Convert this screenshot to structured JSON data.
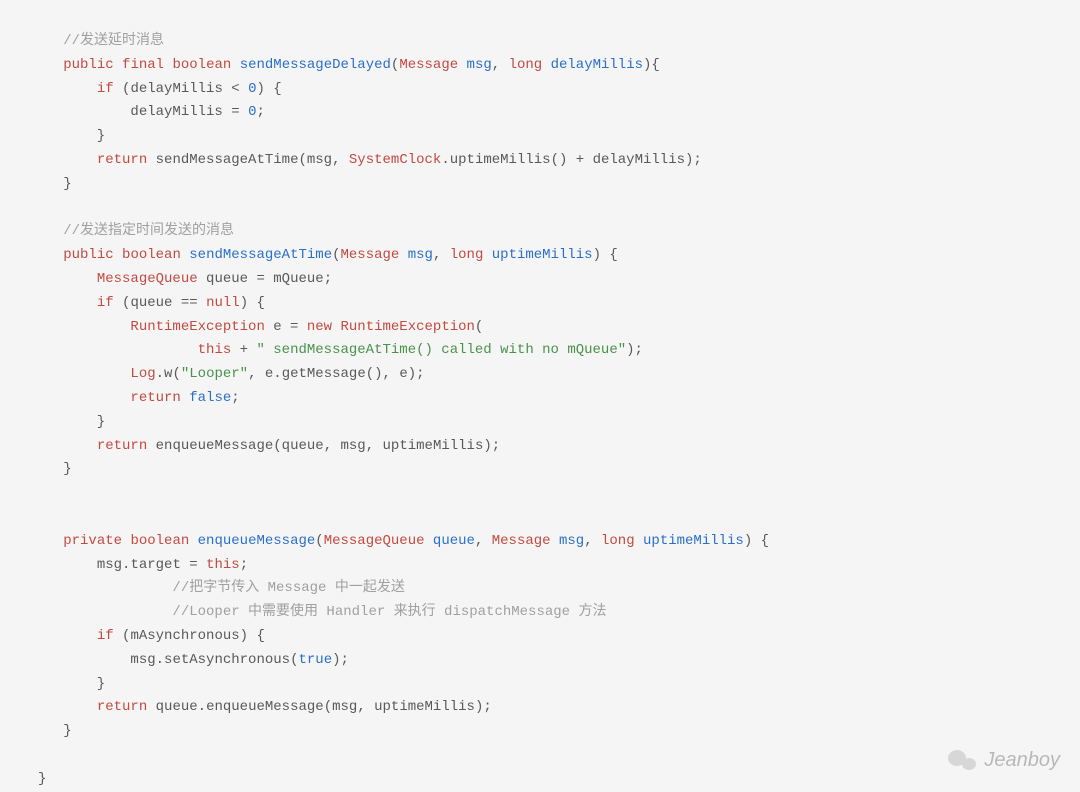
{
  "code": {
    "block1": {
      "comment": "//发送延时消息",
      "mod_public": "public",
      "mod_final": "final",
      "ret_boolean": "boolean",
      "fn_name": "sendMessageDelayed",
      "param_type1": "Message",
      "param_name1": "msg",
      "param_type2": "long",
      "param_name2": "delayMillis",
      "if_kw": "if",
      "cond_lhs": "delayMillis",
      "cond_op": "<",
      "cond_rhs": "0",
      "assign_lhs": "delayMillis",
      "assign_rhs": "0",
      "return_kw": "return",
      "call_fn": "sendMessageAtTime",
      "arg1": "msg",
      "arg2_owner": "SystemClock",
      "arg2_fn": "uptimeMillis",
      "arg2_tail": "delayMillis"
    },
    "block2": {
      "comment": "//发送指定时间发送的消息",
      "mod_public": "public",
      "ret_boolean": "boolean",
      "fn_name": "sendMessageAtTime",
      "param_type1": "Message",
      "param_name1": "msg",
      "param_type2": "long",
      "param_name2": "uptimeMillis",
      "type_mq": "MessageQueue",
      "var_queue": "queue",
      "rhs_mqueue": "mQueue",
      "if_kw": "if",
      "cond_lhs": "queue",
      "cond_op": "==",
      "cond_rhs": "null",
      "type_rte": "RuntimeException",
      "var_e": "e",
      "new_kw": "new",
      "ctor_rte": "RuntimeException",
      "this_kw": "this",
      "str_msg": "\" sendMessageAtTime() called with no mQueue\"",
      "log_owner": "Log",
      "log_fn": "w",
      "log_tag": "\"Looper\"",
      "log_arg2a": "e",
      "log_arg2b": "getMessage",
      "log_arg3": "e",
      "return1_kw": "return",
      "false_kw": "false",
      "return2_kw": "return",
      "call_fn": "enqueueMessage",
      "call_arg1": "queue",
      "call_arg2": "msg",
      "call_arg3": "uptimeMillis"
    },
    "block3": {
      "mod_private": "private",
      "ret_boolean": "boolean",
      "fn_name": "enqueueMessage",
      "param_type1": "MessageQueue",
      "param_name1": "queue",
      "param_type2": "Message",
      "param_name2": "msg",
      "param_type3": "long",
      "param_name3": "uptimeMillis",
      "lhs_owner": "msg",
      "lhs_field": "target",
      "rhs_this": "this",
      "comment1": "//把字节传入 Message 中一起发送",
      "comment2": "//Looper 中需要使用 Handler 来执行 dispatchMessage 方法",
      "if_kw": "if",
      "cond_var": "mAsynchronous",
      "call_owner": "msg",
      "call_fn1": "setAsynchronous",
      "true_kw": "true",
      "return_kw": "return",
      "ret_owner": "queue",
      "ret_fn": "enqueueMessage",
      "ret_arg1": "msg",
      "ret_arg2": "uptimeMillis"
    }
  },
  "watermark": {
    "text": "Jeanboy"
  }
}
